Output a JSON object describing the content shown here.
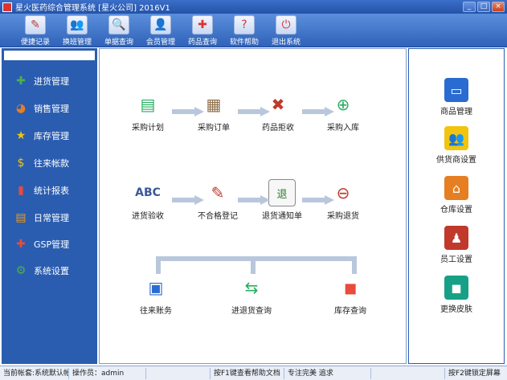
{
  "window": {
    "title": "星火医药综合管理系统 [星火公司] 2016V1",
    "controls": [
      "_",
      "□",
      "×"
    ]
  },
  "toolbar": [
    {
      "label": "便捷记录",
      "icon": "notepad-icon",
      "glyph": "✎",
      "color": "#c0392b"
    },
    {
      "label": "换班管理",
      "icon": "people-icon",
      "glyph": "👥",
      "color": "#2a6bd1"
    },
    {
      "label": "单据查询",
      "icon": "magnifier-icon",
      "glyph": "🔍",
      "color": "#2a6bd1"
    },
    {
      "label": "会员管理",
      "icon": "members-icon",
      "glyph": "👤",
      "color": "#2a6bd1"
    },
    {
      "label": "药品查询",
      "icon": "medicine-box-icon",
      "glyph": "✚",
      "color": "#d33"
    },
    {
      "label": "软件帮助",
      "icon": "help-icon",
      "glyph": "?",
      "color": "#d33"
    },
    {
      "label": "退出系统",
      "icon": "power-icon",
      "glyph": "⏻",
      "color": "#d33"
    }
  ],
  "sidebar": [
    {
      "label": "进货管理",
      "icon": "plus-icon",
      "glyph": "✚",
      "color": "#4caf50"
    },
    {
      "label": "销售管理",
      "icon": "pie-chart-icon",
      "glyph": "◕",
      "color": "#e67e22"
    },
    {
      "label": "库存管理",
      "icon": "star-icon",
      "glyph": "★",
      "color": "#f1c40f"
    },
    {
      "label": "往来帐款",
      "icon": "dollar-icon",
      "glyph": "$",
      "color": "#f1c40f"
    },
    {
      "label": "统计报表",
      "icon": "bar-chart-icon",
      "glyph": "▮",
      "color": "#e74c3c"
    },
    {
      "label": "日常管理",
      "icon": "folder-icon",
      "glyph": "▤",
      "color": "#f39c12"
    },
    {
      "label": "GSP管理",
      "icon": "first-aid-icon",
      "glyph": "✚",
      "color": "#e74c3c"
    },
    {
      "label": "系统设置",
      "icon": "gear-icon",
      "glyph": "⚙",
      "color": "#4caf50"
    }
  ],
  "flow": {
    "row1": [
      {
        "label": "采购计划",
        "icon": "purchase-plan-icon",
        "glyph": "▤",
        "color": "#27ae60"
      },
      {
        "label": "采购订单",
        "icon": "order-box-icon",
        "glyph": "▦",
        "color": "#8d6e4a"
      },
      {
        "label": "药品拒收",
        "icon": "reject-cart-icon",
        "glyph": "✖",
        "color": "#c0392b"
      },
      {
        "label": "采购入库",
        "icon": "cart-add-icon",
        "glyph": "⊕",
        "color": "#27ae60"
      }
    ],
    "row2": [
      {
        "label": "进货验收",
        "icon": "abc-check-icon",
        "glyph": "ABC",
        "color": "#3b5998"
      },
      {
        "label": "不合格登记",
        "icon": "notebook-icon",
        "glyph": "✎",
        "color": "#c0392b"
      },
      {
        "label": "退货通知单",
        "icon": "return-note-icon",
        "glyph": "退",
        "color": "#2c7a2c"
      },
      {
        "label": "采购退货",
        "icon": "cart-remove-icon",
        "glyph": "⊖",
        "color": "#c0392b"
      }
    ],
    "row3": [
      {
        "label": "往来账务",
        "icon": "ledger-book-icon",
        "glyph": "▣",
        "color": "#2a6bd1"
      },
      {
        "label": "进退货查询",
        "icon": "return-query-icon",
        "glyph": "⇆",
        "color": "#27ae60"
      },
      {
        "label": "库存查询",
        "icon": "stock-cubes-icon",
        "glyph": "◼",
        "color": "#e74c3c"
      }
    ]
  },
  "rightbar": [
    {
      "label": "商品管理",
      "icon": "computer-icon",
      "glyph": "▭",
      "color": "#2a6bd1"
    },
    {
      "label": "供货商设置",
      "icon": "suppliers-icon",
      "glyph": "👥",
      "color": "#f1c40f"
    },
    {
      "label": "仓库设置",
      "icon": "warehouse-icon",
      "glyph": "⌂",
      "color": "#e67e22"
    },
    {
      "label": "员工设置",
      "icon": "staff-icon",
      "glyph": "♟",
      "color": "#c0392b"
    },
    {
      "label": "更换皮肤",
      "icon": "skin-cubes-icon",
      "glyph": "◼",
      "color": "#16a085"
    }
  ],
  "status": [
    "当前帐套:系统默认帐套",
    "操作员：admin",
    "",
    "按F1键查看帮助文档",
    "专注完美 追求",
    "",
    "按F2键锁定屏幕"
  ]
}
